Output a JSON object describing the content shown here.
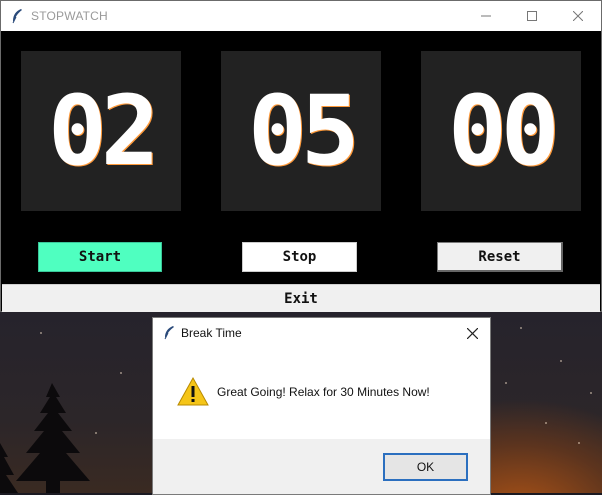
{
  "window": {
    "title": "STOPWATCH",
    "minimize_icon": "minimize-icon",
    "maximize_icon": "maximize-icon",
    "close_icon": "close-icon"
  },
  "display": {
    "hours": "02",
    "minutes": "05",
    "seconds": "00"
  },
  "controls": {
    "start_label": "Start",
    "stop_label": "Stop",
    "reset_label": "Reset",
    "exit_label": "Exit",
    "start_color": "#4fffc0"
  },
  "dialog": {
    "title": "Break Time",
    "message": "Great Going! Relax for 30 Minutes Now!",
    "ok_label": "OK",
    "icon": "warning-icon"
  }
}
